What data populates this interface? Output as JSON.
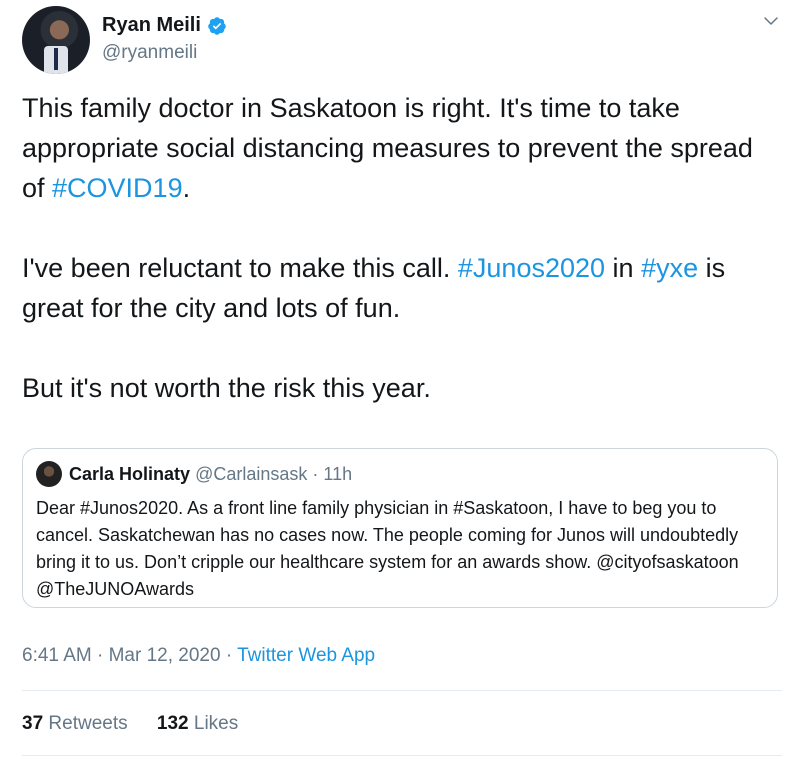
{
  "author": {
    "display_name": "Ryan Meili",
    "handle": "@ryanmeili",
    "verified": true,
    "avatar_icon": "profile-photo"
  },
  "tweet": {
    "paragraphs": [
      [
        {
          "text": "This family doctor in Saskatoon is right. It's time to take appropriate social distancing measures to prevent the spread of "
        },
        {
          "text": "#COVID19",
          "tag": true
        },
        {
          "text": "."
        }
      ],
      [
        {
          "text": "I've been reluctant to make this call. "
        },
        {
          "text": "#Junos2020",
          "tag": true
        },
        {
          "text": " in "
        },
        {
          "text": "#yxe",
          "tag": true
        },
        {
          "text": " is great for the city and lots of fun."
        }
      ],
      [
        {
          "text": "But it's not worth the risk this year."
        }
      ]
    ]
  },
  "quote": {
    "name": "Carla Holinaty",
    "handle": "@Carlainsask",
    "separator": "·",
    "time": "11h",
    "text": "Dear #Junos2020. As a front line family physician in #Saskatoon, I have to beg you to cancel. Saskatchewan has no cases now. The people coming for Junos will undoubtedly bring it to us. Don’t cripple our healthcare system for an awards show. @cityofsaskatoon @TheJUNOAwards"
  },
  "footer": {
    "time": "6:41 AM",
    "separator": "·",
    "date": "Mar 12, 2020",
    "source": "Twitter Web App"
  },
  "stats": {
    "retweets_count": "37",
    "retweets_label": "Retweets",
    "likes_count": "132",
    "likes_label": "Likes"
  },
  "colors": {
    "link": "#1b95e0",
    "text": "#14171a",
    "secondary": "#657786",
    "border": "#ccd6dd"
  }
}
